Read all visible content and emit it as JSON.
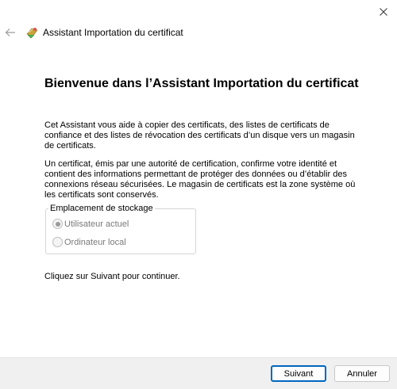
{
  "window": {
    "title": "Assistant Importation du certificat",
    "close_icon": "close-icon",
    "back_icon": "back-arrow-icon",
    "app_icon": "certificate-icon"
  },
  "main": {
    "heading": "Bienvenue dans l’Assistant Importation du certificat",
    "paragraph1": "Cet Assistant vous aide à copier des certificats, des listes de certificats de confiance et des listes de révocation des certificats d’un disque vers un magasin de certificats.",
    "paragraph2": "Un certificat, émis par une autorité de certification, confirme votre identité et contient des informations permettant de protéger des données ou d’établir des connexions réseau sécurisées. Le magasin de certificats est la zone système où les certificats sont conservés.",
    "storage": {
      "legend": "Emplacement de stockage",
      "options": [
        {
          "label": "Utilisateur actuel",
          "selected": true,
          "disabled": true
        },
        {
          "label": "Ordinateur local",
          "selected": false,
          "disabled": true
        }
      ]
    },
    "paragraph3": "Cliquez sur Suivant pour continuer."
  },
  "footer": {
    "next_label": "Suivant",
    "cancel_label": "Annuler"
  },
  "colors": {
    "accent": "#0067c0",
    "footer_bg": "#f0f0f0",
    "disabled_text": "#7a7a7a"
  }
}
